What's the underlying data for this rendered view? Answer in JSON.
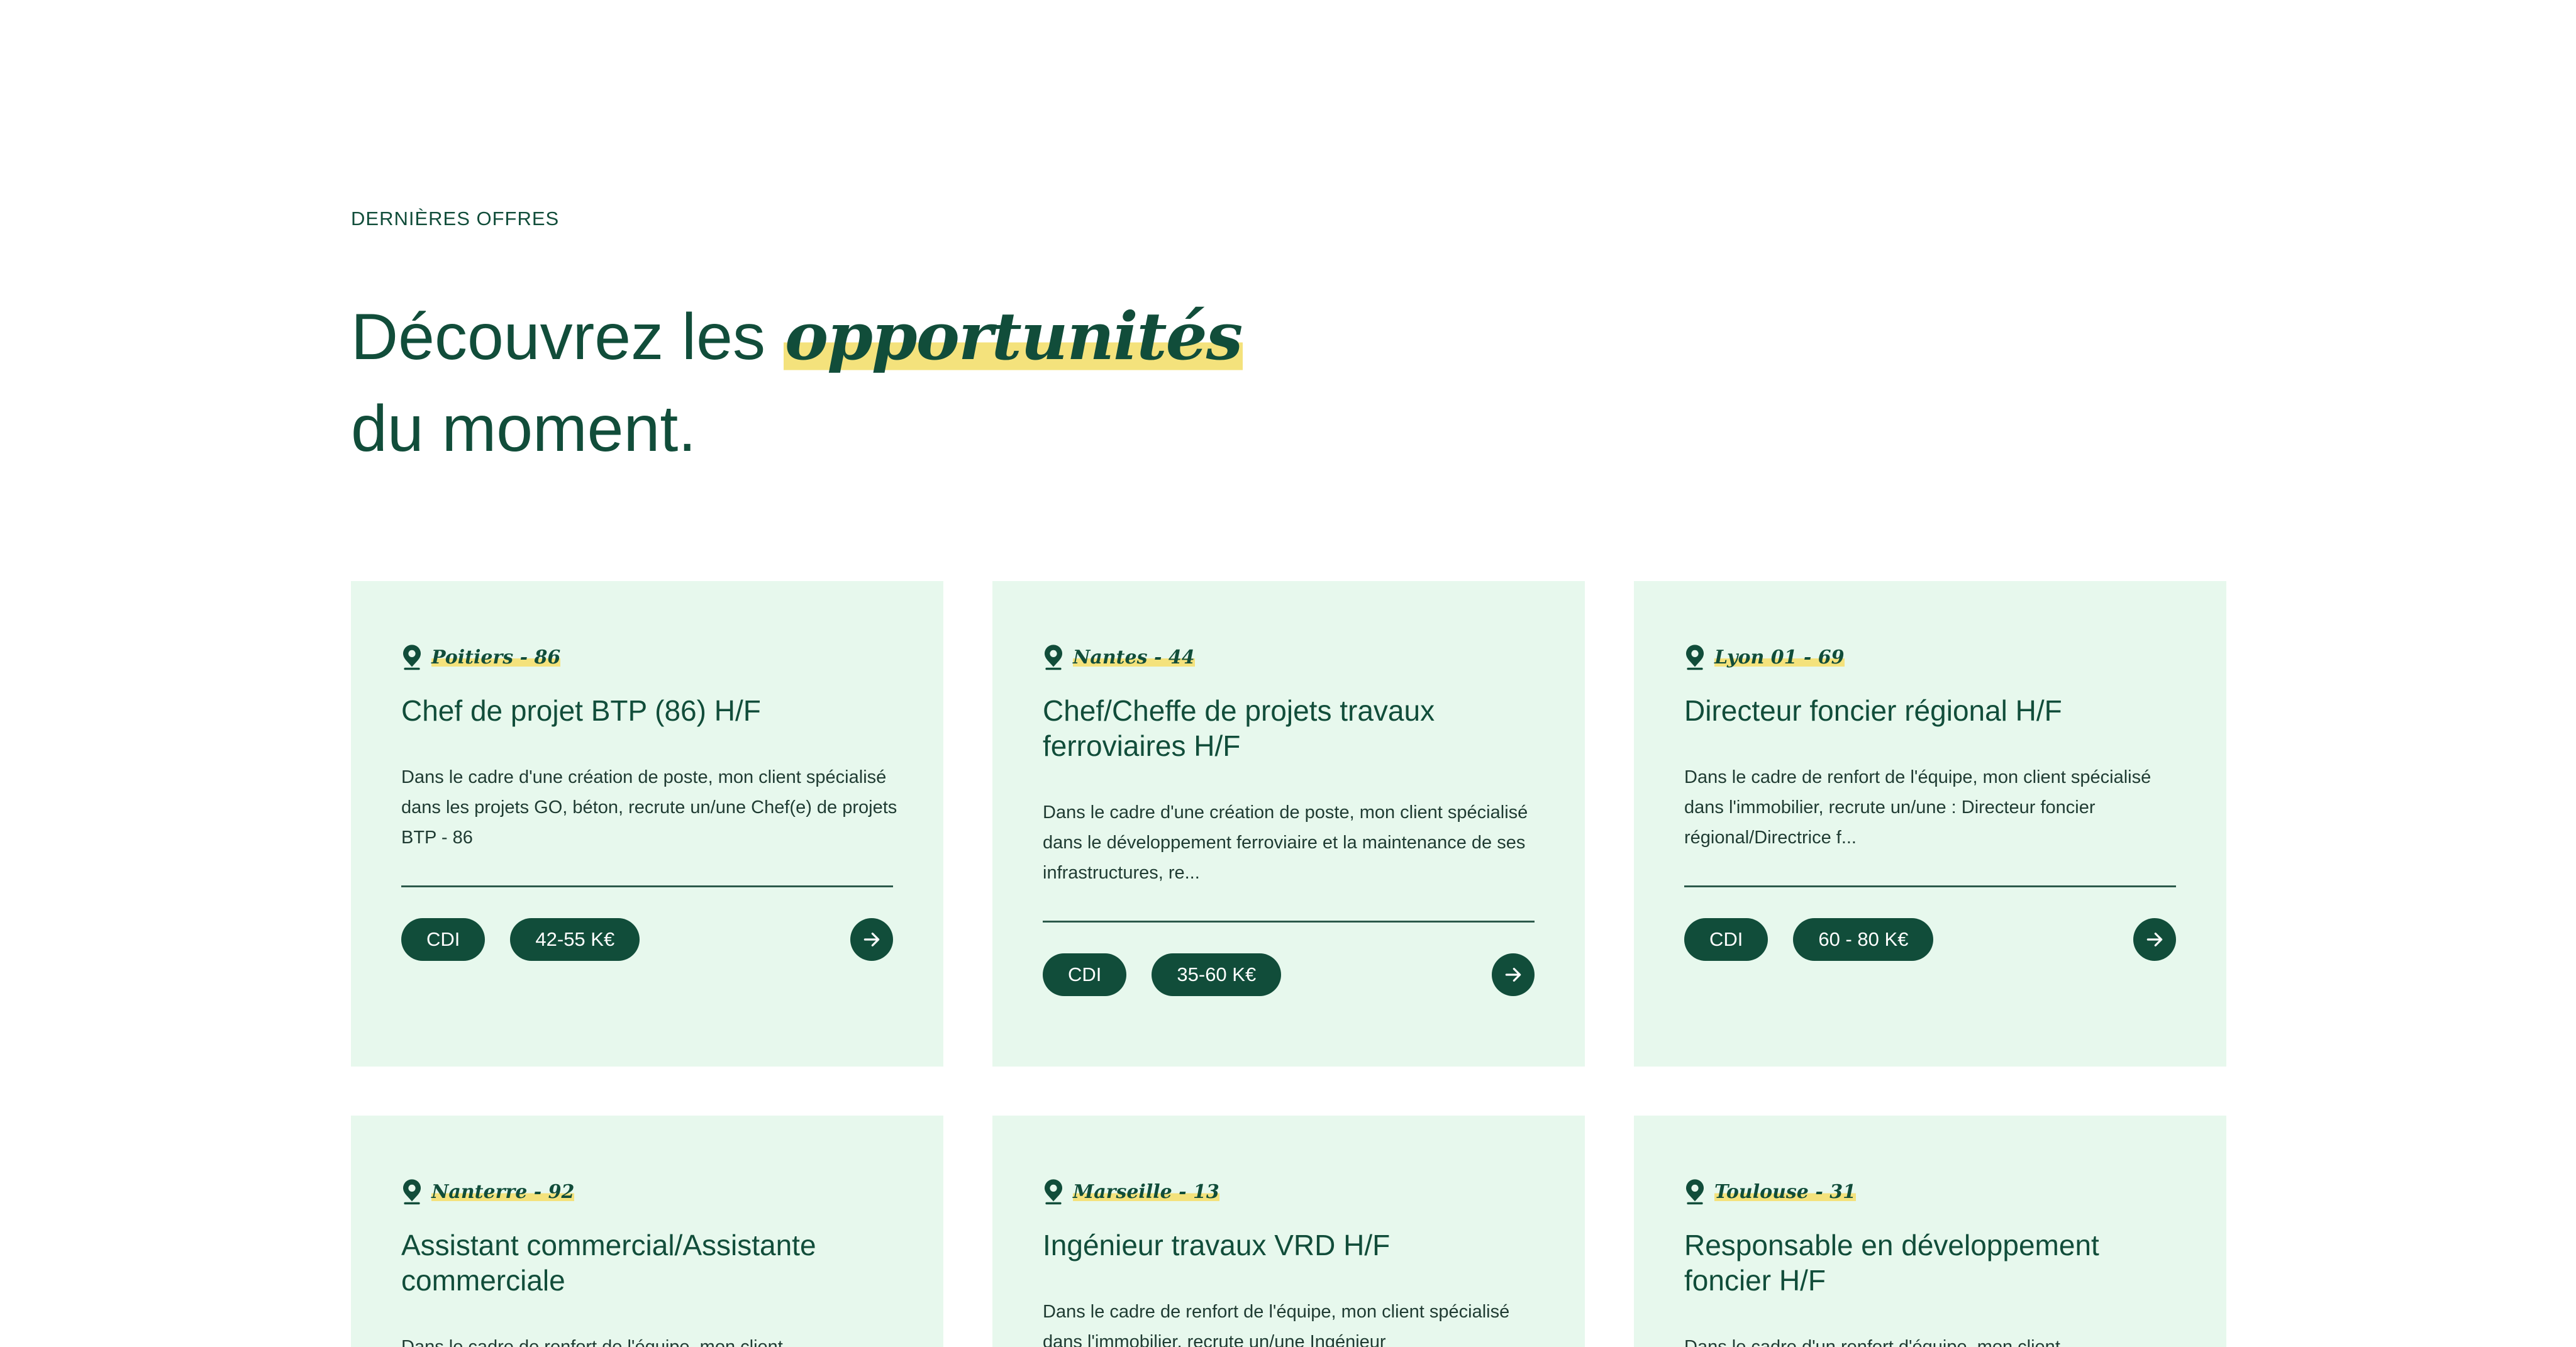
{
  "section": {
    "eyebrow": "DERNIÈRES OFFRES",
    "headline_part1": "Découvrez les ",
    "headline_highlight": "opportunités",
    "headline_part2": "du moment."
  },
  "colors": {
    "brand_green": "#114d3a",
    "card_background": "#e7f8ed",
    "highlight_yellow": "#f4e27c"
  },
  "offers": [
    {
      "location": "Poitiers - 86",
      "title": "Chef de projet BTP (86) H/F",
      "description": "Dans le cadre d'une création de poste, mon client spécialisé dans les projets GO, béton, recrute un/une Chef(e) de projets BTP - 86",
      "contract": "CDI",
      "salary": "42-55 K€",
      "icon": "map-pin-icon"
    },
    {
      "location": "Nantes - 44",
      "title": "Chef/Cheffe de projets travaux ferroviaires H/F",
      "description": "Dans le cadre d'une création de poste, mon client spécialisé dans le développement ferroviaire et la maintenance de ses infrastructures, re...",
      "contract": "CDI",
      "salary": "35-60 K€",
      "icon": "map-pin-icon"
    },
    {
      "location": "Lyon 01 - 69",
      "title": "Directeur foncier régional H/F",
      "description": "Dans le cadre de renfort de l'équipe, mon client spécialisé dans l'immobilier, recrute un/une : Directeur foncier régional/Directrice f...",
      "contract": "CDI",
      "salary": "60 - 80 K€",
      "icon": "map-pin-icon"
    },
    {
      "location": "Nanterre - 92",
      "title": "Assistant commercial/Assistante commerciale",
      "description": "Dans le cadre de renfort de l'équipe, mon client",
      "icon": "map-pin-icon"
    },
    {
      "location": "Marseille - 13",
      "title": "Ingénieur travaux VRD H/F",
      "description": "Dans le cadre de renfort de l'équipe, mon client spécialisé dans l'immobilier, recrute un/une Ingénieur",
      "icon": "map-pin-icon"
    },
    {
      "location": "Toulouse - 31",
      "title": "Responsable en développement foncier H/F",
      "description": "Dans le cadre d'un renfort d'équipe, mon client",
      "icon": "map-pin-icon"
    }
  ]
}
